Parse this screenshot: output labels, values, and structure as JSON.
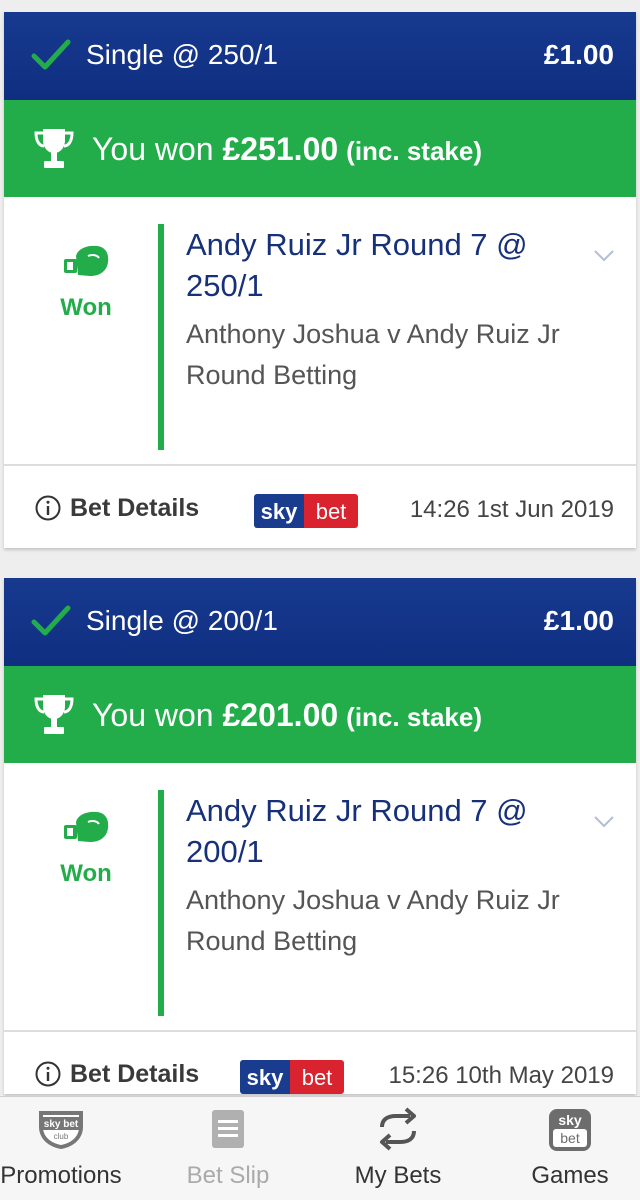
{
  "bets": [
    {
      "bet_type": "Single @ 250/1",
      "stake": "£1.00",
      "win_prefix": "You won ",
      "win_amount": "£251.00",
      "win_suffix": "(inc. stake)",
      "status": "Won",
      "selection_title": "Andy Ruiz Jr Round 7 @ 250/1",
      "event_name": "Anthony Joshua v Andy Ruiz Jr",
      "market": "Round Betting",
      "details_label": "Bet Details",
      "timestamp": "14:26 1st Jun 2019"
    },
    {
      "bet_type": "Single @ 200/1",
      "stake": "£1.00",
      "win_prefix": "You won ",
      "win_amount": "£201.00",
      "win_suffix": "(inc. stake)",
      "status": "Won",
      "selection_title": "Andy Ruiz Jr Round 7 @ 200/1",
      "event_name": "Anthony Joshua v Andy Ruiz Jr",
      "market": "Round Betting",
      "details_label": "Bet Details",
      "timestamp": "15:26 10th May 2019"
    }
  ],
  "logo": {
    "sky": "sky",
    "bet": "bet"
  },
  "nav": [
    {
      "label": "Promotions",
      "icon": "skybet-club-icon",
      "badge_top": "sky bet",
      "badge_bottom": "club"
    },
    {
      "label": "Bet Slip",
      "icon": "bet-slip-icon"
    },
    {
      "label": "My Bets",
      "icon": "my-bets-icon"
    },
    {
      "label": "Games",
      "icon": "sky-bet-games-icon",
      "badge_top": "sky",
      "badge_bottom": "bet"
    }
  ],
  "colors": {
    "header_blue": "#0f2e80",
    "win_green": "#22ad4a",
    "selection_blue": "#16307a",
    "logo_blue": "#1a3c8f",
    "logo_red": "#d9232e"
  }
}
